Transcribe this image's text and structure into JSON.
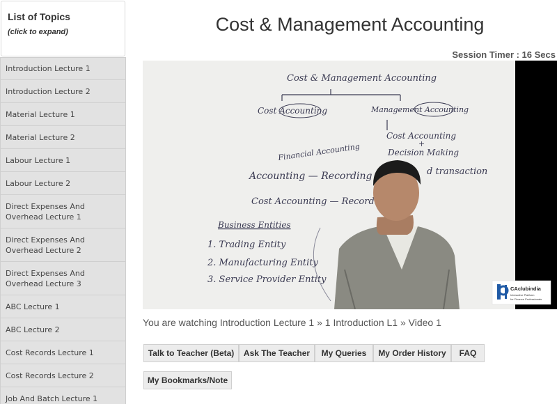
{
  "sidebar": {
    "title": "List of Topics",
    "subtitle": "(click to expand)",
    "items": [
      {
        "label": "Introduction Lecture 1"
      },
      {
        "label": "Introduction Lecture 2"
      },
      {
        "label": "Material Lecture 1"
      },
      {
        "label": "Material Lecture 2"
      },
      {
        "label": "Labour Lecture 1"
      },
      {
        "label": "Labour Lecture 2"
      },
      {
        "label": "Direct Expenses And Overhead Lecture 1"
      },
      {
        "label": "Direct Expenses And Overhead Lecture 2"
      },
      {
        "label": "Direct Expenses And Overhead Lecture 3"
      },
      {
        "label": "ABC Lecture 1"
      },
      {
        "label": "ABC Lecture 2"
      },
      {
        "label": "Cost Records Lecture 1"
      },
      {
        "label": "Cost Records Lecture 2"
      },
      {
        "label": "Job And Batch Lecture 1"
      }
    ]
  },
  "main": {
    "title": "Cost & Management Accounting",
    "session_timer": "Session Timer : 16 Secs",
    "breadcrumb": "You are watching Introduction Lecture 1 » 1 Introduction L1 » Video 1",
    "video": {
      "board": {
        "heading": "Cost & Management Accounting",
        "left_branch": "Cost Accounting",
        "right_branch": "Management Accounting",
        "right_sub1": "Cost Accounting",
        "right_plus": "+",
        "right_sub2": "Decision Making",
        "financial": "Financial Accounting",
        "line1": "Accounting — Recording of",
        "line1_end": "d transaction",
        "line2": "Cost Accounting — Recording",
        "entities_heading": "Business Entities",
        "entity1": "1. Trading Entity",
        "entity2": "2. Manufacturing Entity",
        "entity3": "3. Service Provider Entity"
      },
      "logo_name": "CAclubindia",
      "logo_tagline1": "Interactive Platform",
      "logo_tagline2": "for Finance Professionals"
    },
    "buttons": {
      "talk": "Talk to Teacher (Beta)",
      "ask": "Ask The Teacher",
      "queries": "My Queries",
      "orders": "My Order History",
      "faq": "FAQ",
      "bookmarks": "My Bookmarks/Note"
    }
  }
}
